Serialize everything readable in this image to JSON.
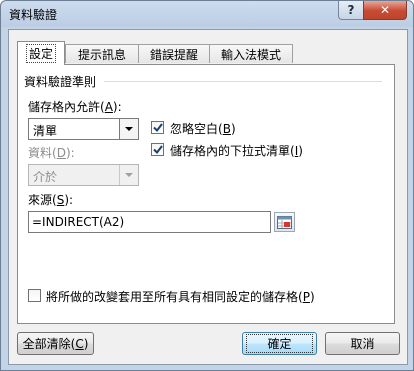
{
  "window": {
    "title": "資料驗證",
    "help_label": "?",
    "close_label": "✕"
  },
  "tabs": [
    {
      "label": "設定",
      "active": true
    },
    {
      "label": "提示訊息",
      "active": false
    },
    {
      "label": "錯誤提醒",
      "active": false
    },
    {
      "label": "輸入法模式",
      "active": false
    }
  ],
  "criteria": {
    "section_title": "資料驗證準則",
    "allow": {
      "label": "儲存格內允許",
      "hotkey": "A",
      "value": "清單"
    },
    "data": {
      "label": "資料",
      "hotkey": "D",
      "value": "介於"
    },
    "ignore_blank": {
      "label": "忽略空白",
      "hotkey": "B",
      "checked": true
    },
    "in_cell_dropdown": {
      "label": "儲存格內的下拉式清單",
      "hotkey": "I",
      "checked": true
    },
    "source": {
      "label": "來源",
      "hotkey": "S",
      "value": "=INDIRECT(A2)"
    }
  },
  "apply_all": {
    "label": "將所做的改變套用至所有具有相同設定的儲存格",
    "hotkey": "P",
    "checked": false
  },
  "buttons": {
    "clear_all": {
      "label": "全部清除",
      "hotkey": "C"
    },
    "ok": {
      "label": "確定"
    },
    "cancel": {
      "label": "取消"
    }
  },
  "colors": {
    "frame": "#c4d4e7",
    "client": "#f0f0f0",
    "close_button": "#c74a33",
    "default_button": "#bee6fd",
    "disabled_text": "#8d8d8d"
  }
}
